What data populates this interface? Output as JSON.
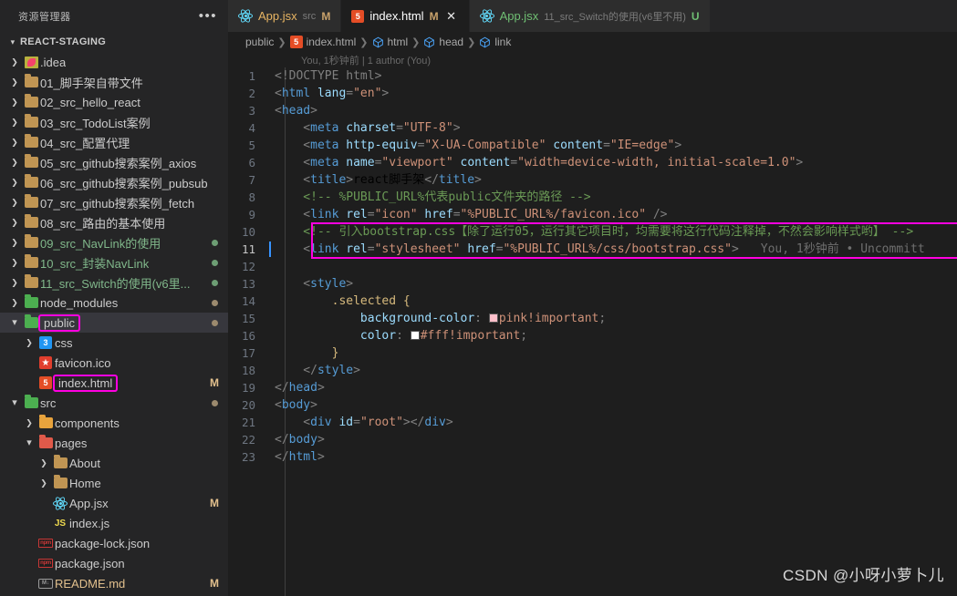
{
  "colors": {
    "accent_highlight": "#ff00e0",
    "editor_bg": "#1e1e1e",
    "sidebar_bg": "#252526",
    "selected_row": "#37373d",
    "modified_badge": "#e2c08d",
    "untracked_green": "#81b88b"
  },
  "sidebar": {
    "title": "资源管理器",
    "actions_label": "•••",
    "project": {
      "label": "REACT-STAGING",
      "expanded": true
    },
    "items": [
      {
        "label": ".idea",
        "icon": "idea-folder-icon",
        "indent": 1,
        "twisty": "collapsed",
        "color": "normal",
        "badge": "",
        "dot": ""
      },
      {
        "label": "01_脚手架自带文件",
        "icon": "folder-icon",
        "indent": 1,
        "twisty": "collapsed",
        "color": "normal",
        "badge": "",
        "dot": ""
      },
      {
        "label": "02_src_hello_react",
        "icon": "folder-icon",
        "indent": 1,
        "twisty": "collapsed",
        "color": "normal",
        "badge": "",
        "dot": ""
      },
      {
        "label": "03_src_TodoList案例",
        "icon": "folder-icon",
        "indent": 1,
        "twisty": "collapsed",
        "color": "normal",
        "badge": "",
        "dot": ""
      },
      {
        "label": "04_src_配置代理",
        "icon": "folder-icon",
        "indent": 1,
        "twisty": "collapsed",
        "color": "normal",
        "badge": "",
        "dot": ""
      },
      {
        "label": "05_src_github搜索案例_axios",
        "icon": "folder-icon",
        "indent": 1,
        "twisty": "collapsed",
        "color": "normal",
        "badge": "",
        "dot": ""
      },
      {
        "label": "06_src_github搜索案例_pubsub",
        "icon": "folder-icon",
        "indent": 1,
        "twisty": "collapsed",
        "color": "normal",
        "badge": "",
        "dot": ""
      },
      {
        "label": "07_src_github搜索案例_fetch",
        "icon": "folder-icon",
        "indent": 1,
        "twisty": "collapsed",
        "color": "normal",
        "badge": "",
        "dot": ""
      },
      {
        "label": "08_src_路由的基本使用",
        "icon": "folder-icon",
        "indent": 1,
        "twisty": "collapsed",
        "color": "normal",
        "badge": "",
        "dot": ""
      },
      {
        "label": "09_src_NavLink的使用",
        "icon": "folder-icon",
        "indent": 1,
        "twisty": "collapsed",
        "color": "green",
        "badge": "",
        "dot": "green"
      },
      {
        "label": "10_src_封装NavLink",
        "icon": "folder-icon",
        "indent": 1,
        "twisty": "collapsed",
        "color": "green",
        "badge": "",
        "dot": "green"
      },
      {
        "label": "11_src_Switch的使用(v6里...",
        "icon": "folder-icon",
        "indent": 1,
        "twisty": "collapsed",
        "color": "green",
        "badge": "",
        "dot": "green"
      },
      {
        "label": "node_modules",
        "icon": "node-folder-icon",
        "indent": 1,
        "twisty": "collapsed",
        "color": "normal",
        "badge": "",
        "dot": "tan"
      },
      {
        "label": "public",
        "icon": "public-folder-icon",
        "indent": 1,
        "twisty": "expanded",
        "color": "normal",
        "badge": "",
        "dot": "tan",
        "highlighted": true,
        "selected": true
      },
      {
        "label": "css",
        "icon": "css-folder-icon",
        "indent": 2,
        "twisty": "collapsed",
        "color": "normal",
        "badge": "",
        "dot": ""
      },
      {
        "label": "favicon.ico",
        "icon": "favicon-icon",
        "indent": 2,
        "twisty": "none",
        "color": "normal",
        "badge": "",
        "dot": ""
      },
      {
        "label": "index.html",
        "icon": "html5-icon",
        "indent": 2,
        "twisty": "none",
        "color": "normal",
        "badge": "M",
        "dot": "",
        "highlighted": true
      },
      {
        "label": "src",
        "icon": "src-folder-icon",
        "indent": 1,
        "twisty": "expanded",
        "color": "normal",
        "badge": "",
        "dot": "tan"
      },
      {
        "label": "components",
        "icon": "components-folder-icon",
        "indent": 2,
        "twisty": "collapsed",
        "color": "normal",
        "badge": "",
        "dot": ""
      },
      {
        "label": "pages",
        "icon": "pages-folder-icon",
        "indent": 2,
        "twisty": "expanded",
        "color": "normal",
        "badge": "",
        "dot": ""
      },
      {
        "label": "About",
        "icon": "folder-icon",
        "indent": 3,
        "twisty": "collapsed",
        "color": "normal",
        "badge": "",
        "dot": ""
      },
      {
        "label": "Home",
        "icon": "folder-icon",
        "indent": 3,
        "twisty": "collapsed",
        "color": "normal",
        "badge": "",
        "dot": ""
      },
      {
        "label": "App.jsx",
        "icon": "react-icon",
        "indent": 3,
        "twisty": "none",
        "color": "normal",
        "badge": "M",
        "dot": ""
      },
      {
        "label": "index.js",
        "icon": "js-icon",
        "indent": 3,
        "twisty": "none",
        "color": "normal",
        "badge": "",
        "dot": ""
      },
      {
        "label": "package-lock.json",
        "icon": "npm-icon",
        "indent": 2,
        "twisty": "none",
        "color": "normal",
        "badge": "",
        "dot": ""
      },
      {
        "label": "package.json",
        "icon": "npm-icon",
        "indent": 2,
        "twisty": "none",
        "color": "normal",
        "badge": "",
        "dot": ""
      },
      {
        "label": "README.md",
        "icon": "markdown-icon",
        "indent": 2,
        "twisty": "none",
        "color": "tan",
        "badge": "M",
        "dot": ""
      }
    ]
  },
  "tabs": [
    {
      "label": "App.jsx",
      "desc": "src",
      "badge": "M",
      "badge_kind": "modified",
      "icon": "react-icon",
      "active": false,
      "label_color": "orange",
      "closable": false
    },
    {
      "label": "index.html",
      "desc": "",
      "badge": "M",
      "badge_kind": "modified",
      "icon": "html5-icon",
      "active": true,
      "label_color": "white",
      "closable": true
    },
    {
      "label": "App.jsx",
      "desc": "11_src_Switch的使用(v6里不用)",
      "badge": "U",
      "badge_kind": "untracked",
      "icon": "react-icon",
      "active": false,
      "label_color": "green",
      "closable": false
    }
  ],
  "breadcrumbs": [
    {
      "label": "public",
      "icon": ""
    },
    {
      "label": "index.html",
      "icon": "html5-icon"
    },
    {
      "label": "html",
      "icon": "symbol-cube-icon"
    },
    {
      "label": "head",
      "icon": "symbol-cube-icon"
    },
    {
      "label": "link",
      "icon": "symbol-cube-icon"
    }
  ],
  "blame_header": "You, 1秒钟前 | 1 author (You)",
  "inline_blame": "You, 1秒钟前 • Uncommitt",
  "code": {
    "first_line": 1,
    "active_line": 11,
    "lines": [
      {
        "n": 1,
        "tokens": [
          {
            "t": "<!DOCTYPE html>",
            "c": "t-doctype"
          }
        ]
      },
      {
        "n": 2,
        "tokens": [
          {
            "t": "<",
            "c": "t-punct"
          },
          {
            "t": "html",
            "c": "t-tag"
          },
          {
            "t": " ",
            "c": "t-punct"
          },
          {
            "t": "lang",
            "c": "t-attr"
          },
          {
            "t": "=",
            "c": "t-punct"
          },
          {
            "t": "\"en\"",
            "c": "t-str"
          },
          {
            "t": ">",
            "c": "t-punct"
          }
        ]
      },
      {
        "n": 3,
        "tokens": [
          {
            "t": "<",
            "c": "t-punct"
          },
          {
            "t": "head",
            "c": "t-tag"
          },
          {
            "t": ">",
            "c": "t-punct"
          }
        ]
      },
      {
        "n": 4,
        "tokens": [
          {
            "t": "    <",
            "c": "t-punct"
          },
          {
            "t": "meta",
            "c": "t-tag"
          },
          {
            "t": " ",
            "c": "t-punct"
          },
          {
            "t": "charset",
            "c": "t-attr"
          },
          {
            "t": "=",
            "c": "t-punct"
          },
          {
            "t": "\"UTF-8\"",
            "c": "t-str"
          },
          {
            "t": ">",
            "c": "t-punct"
          }
        ]
      },
      {
        "n": 5,
        "tokens": [
          {
            "t": "    <",
            "c": "t-punct"
          },
          {
            "t": "meta",
            "c": "t-tag"
          },
          {
            "t": " ",
            "c": "t-punct"
          },
          {
            "t": "http-equiv",
            "c": "t-attr"
          },
          {
            "t": "=",
            "c": "t-punct"
          },
          {
            "t": "\"X-UA-Compatible\"",
            "c": "t-str"
          },
          {
            "t": " ",
            "c": "t-punct"
          },
          {
            "t": "content",
            "c": "t-attr"
          },
          {
            "t": "=",
            "c": "t-punct"
          },
          {
            "t": "\"IE=edge\"",
            "c": "t-str"
          },
          {
            "t": ">",
            "c": "t-punct"
          }
        ]
      },
      {
        "n": 6,
        "tokens": [
          {
            "t": "    <",
            "c": "t-punct"
          },
          {
            "t": "meta",
            "c": "t-tag"
          },
          {
            "t": " ",
            "c": "t-punct"
          },
          {
            "t": "name",
            "c": "t-attr"
          },
          {
            "t": "=",
            "c": "t-punct"
          },
          {
            "t": "\"viewport\"",
            "c": "t-str"
          },
          {
            "t": " ",
            "c": "t-punct"
          },
          {
            "t": "content",
            "c": "t-attr"
          },
          {
            "t": "=",
            "c": "t-punct"
          },
          {
            "t": "\"width=device-width, initial-scale=1.0\"",
            "c": "t-str"
          },
          {
            "t": ">",
            "c": "t-punct"
          }
        ]
      },
      {
        "n": 7,
        "tokens": [
          {
            "t": "    <",
            "c": "t-punct"
          },
          {
            "t": "title",
            "c": "t-tag"
          },
          {
            "t": ">",
            "c": "t-punct"
          },
          {
            "t": "react脚手架",
            "c": "t-plain"
          },
          {
            "t": "</",
            "c": "t-punct"
          },
          {
            "t": "title",
            "c": "t-tag"
          },
          {
            "t": ">",
            "c": "t-punct"
          }
        ]
      },
      {
        "n": 8,
        "tokens": [
          {
            "t": "    <!-- %PUBLIC_URL%代表public文件夹的路径 -->",
            "c": "t-com"
          }
        ]
      },
      {
        "n": 9,
        "tokens": [
          {
            "t": "    <",
            "c": "t-punct"
          },
          {
            "t": "link",
            "c": "t-tag"
          },
          {
            "t": " ",
            "c": "t-punct"
          },
          {
            "t": "rel",
            "c": "t-attr"
          },
          {
            "t": "=",
            "c": "t-punct"
          },
          {
            "t": "\"icon\"",
            "c": "t-str"
          },
          {
            "t": " ",
            "c": "t-punct"
          },
          {
            "t": "href",
            "c": "t-attr"
          },
          {
            "t": "=",
            "c": "t-punct"
          },
          {
            "t": "\"%PUBLIC_URL%/favicon.ico\"",
            "c": "t-str"
          },
          {
            "t": " />",
            "c": "t-punct"
          }
        ]
      },
      {
        "n": 10,
        "tokens": [
          {
            "t": "    <!-- 引入bootstrap.css【除了运行05，运行其它项目时，均需要将这行代码注释掉，不然会影响样式哟】 -->",
            "c": "t-com"
          }
        ]
      },
      {
        "n": 11,
        "tokens": [
          {
            "t": "    <",
            "c": "t-punct"
          },
          {
            "t": "link",
            "c": "t-tag"
          },
          {
            "t": " ",
            "c": "t-punct"
          },
          {
            "t": "rel",
            "c": "t-attr"
          },
          {
            "t": "=",
            "c": "t-punct"
          },
          {
            "t": "\"stylesheet\"",
            "c": "t-str"
          },
          {
            "t": " ",
            "c": "t-punct"
          },
          {
            "t": "href",
            "c": "t-attr"
          },
          {
            "t": "=",
            "c": "t-punct"
          },
          {
            "t": "\"%PUBLIC_URL%/css/bootstrap.css\"",
            "c": "t-str"
          },
          {
            "t": ">",
            "c": "t-punct"
          }
        ]
      },
      {
        "n": 12,
        "tokens": []
      },
      {
        "n": 13,
        "tokens": [
          {
            "t": "    <",
            "c": "t-punct"
          },
          {
            "t": "style",
            "c": "t-tag"
          },
          {
            "t": ">",
            "c": "t-punct"
          }
        ]
      },
      {
        "n": 14,
        "tokens": [
          {
            "t": "        ",
            "c": "t-punct"
          },
          {
            "t": ".selected",
            "c": "t-sel"
          },
          {
            "t": " ",
            "c": "t-punct"
          },
          {
            "t": "{",
            "c": "t-brace"
          }
        ]
      },
      {
        "n": 15,
        "tokens": [
          {
            "t": "            ",
            "c": "t-punct"
          },
          {
            "t": "background-color",
            "c": "t-prop"
          },
          {
            "t": ": ",
            "c": "t-punct"
          },
          {
            "t": "SWATCH:#ffc0cb",
            "c": "swatch"
          },
          {
            "t": "pink!important",
            "c": "t-val"
          },
          {
            "t": ";",
            "c": "t-punct"
          }
        ]
      },
      {
        "n": 16,
        "tokens": [
          {
            "t": "            ",
            "c": "t-punct"
          },
          {
            "t": "color",
            "c": "t-prop"
          },
          {
            "t": ": ",
            "c": "t-punct"
          },
          {
            "t": "SWATCH:#ffffff",
            "c": "swatch"
          },
          {
            "t": "#fff!important",
            "c": "t-val"
          },
          {
            "t": ";",
            "c": "t-punct"
          }
        ]
      },
      {
        "n": 17,
        "tokens": [
          {
            "t": "        ",
            "c": "t-punct"
          },
          {
            "t": "}",
            "c": "t-brace"
          }
        ]
      },
      {
        "n": 18,
        "tokens": [
          {
            "t": "    </",
            "c": "t-punct"
          },
          {
            "t": "style",
            "c": "t-tag"
          },
          {
            "t": ">",
            "c": "t-punct"
          }
        ]
      },
      {
        "n": 19,
        "tokens": [
          {
            "t": "</",
            "c": "t-punct"
          },
          {
            "t": "head",
            "c": "t-tag"
          },
          {
            "t": ">",
            "c": "t-punct"
          }
        ]
      },
      {
        "n": 20,
        "tokens": [
          {
            "t": "<",
            "c": "t-punct"
          },
          {
            "t": "body",
            "c": "t-tag"
          },
          {
            "t": ">",
            "c": "t-punct"
          }
        ]
      },
      {
        "n": 21,
        "tokens": [
          {
            "t": "    <",
            "c": "t-punct"
          },
          {
            "t": "div",
            "c": "t-tag"
          },
          {
            "t": " ",
            "c": "t-punct"
          },
          {
            "t": "id",
            "c": "t-attr"
          },
          {
            "t": "=",
            "c": "t-punct"
          },
          {
            "t": "\"root\"",
            "c": "t-str"
          },
          {
            "t": "></",
            "c": "t-punct"
          },
          {
            "t": "div",
            "c": "t-tag"
          },
          {
            "t": ">",
            "c": "t-punct"
          }
        ]
      },
      {
        "n": 22,
        "tokens": [
          {
            "t": "</",
            "c": "t-punct"
          },
          {
            "t": "body",
            "c": "t-tag"
          },
          {
            "t": ">",
            "c": "t-punct"
          }
        ]
      },
      {
        "n": 23,
        "tokens": [
          {
            "t": "</",
            "c": "t-punct"
          },
          {
            "t": "html",
            "c": "t-tag"
          },
          {
            "t": ">",
            "c": "t-punct"
          }
        ]
      }
    ],
    "highlight_box": {
      "from_line": 10,
      "to_line": 11,
      "color": "#ff00e0"
    }
  },
  "watermark": "CSDN @小呀小萝卜儿"
}
